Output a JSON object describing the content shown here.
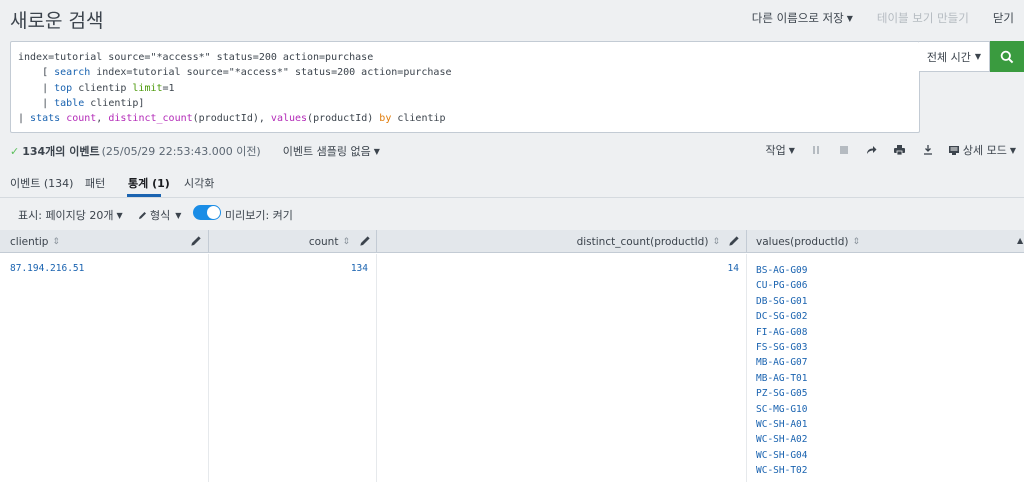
{
  "header": {
    "title": "새로운 검색",
    "save_as": "다른 이름으로 저장",
    "create_table_view": "테이블 보기 만들기",
    "close": "닫기"
  },
  "query": {
    "line1": "index=tutorial source=\"*access*\" status=200 action=purchase",
    "line2_prefix": "    [ ",
    "line2_kw": "search",
    "line2_rest": " index=tutorial source=\"*access*\" status=200 action=purchase",
    "line3_prefix": "    | ",
    "line3_kw": "top",
    "line3_mid": " clientip ",
    "line3_arg": "limit",
    "line3_rest": "=1",
    "line4_prefix": "    | ",
    "line4_kw": "table",
    "line4_rest": " clientip]",
    "line5_prefix": "| ",
    "line5_kw": "stats",
    "line5_sp": " ",
    "line5_f1": "count",
    "line5_c1": ", ",
    "line5_f2": "distinct_count",
    "line5_a2": "(productId), ",
    "line5_f3": "values",
    "line5_a3": "(productId) ",
    "line5_by": "by",
    "line5_rest": " clientip"
  },
  "time_picker": {
    "label": "전체 시간"
  },
  "status": {
    "count": "134개의 이벤트",
    "timestamp": "(25/05/29 22:53:43.000 이전)",
    "sampling": "이벤트 샘플링 없음",
    "job": "작업",
    "verbose_mode": "상세 모드"
  },
  "tabs": [
    {
      "label": "이벤트 (134)"
    },
    {
      "label": "패턴"
    },
    {
      "label": "통계 (1)"
    },
    {
      "label": "시각화"
    }
  ],
  "options": {
    "display": "표시: 페이지당 20개",
    "format": "형식",
    "preview": "미리보기: 켜기"
  },
  "table": {
    "columns": [
      "clientip",
      "count",
      "distinct_count(productId)",
      "values(productId)"
    ],
    "row": {
      "clientip": "87.194.216.51",
      "count": "134",
      "distinct_count": "14",
      "values": [
        "BS-AG-G09",
        "CU-PG-G06",
        "DB-SG-G01",
        "DC-SG-G02",
        "FI-AG-G08",
        "FS-SG-G03",
        "MB-AG-G07",
        "MB-AG-T01",
        "PZ-SG-G05",
        "SC-MG-G10",
        "WC-SH-A01",
        "WC-SH-A02",
        "WC-SH-G04",
        "WC-SH-T02"
      ]
    }
  },
  "colors": {
    "accent_blue": "#1a63b0",
    "search_green": "#3a9b3f",
    "toggle_blue": "#1a8de6"
  }
}
